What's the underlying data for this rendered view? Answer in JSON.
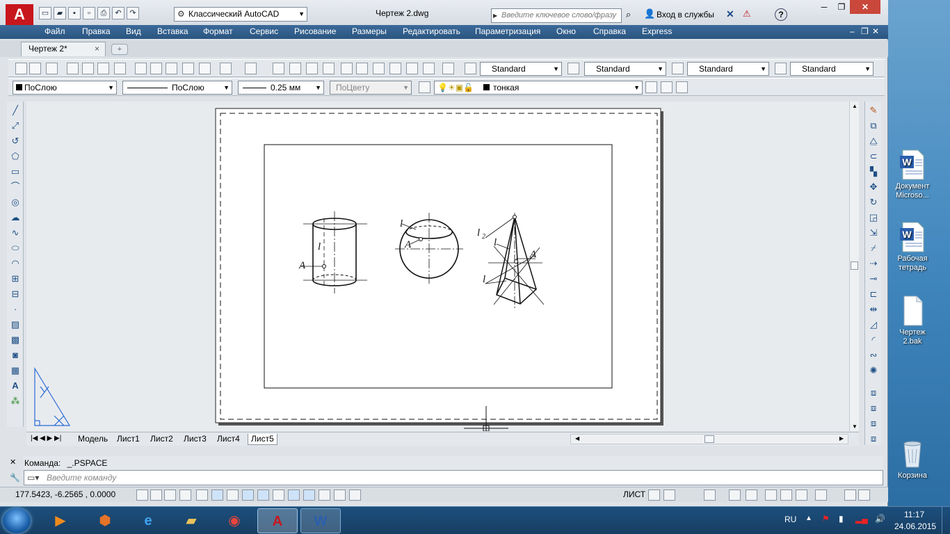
{
  "app": {
    "logo_letter": "A",
    "workspace": "Классический AutoCAD",
    "doc_title": "Чертеж 2.dwg",
    "search_placeholder": "Введите ключевое слово/фразу",
    "signin": "Вход в службы",
    "help": "?"
  },
  "menu": [
    "Файл",
    "Правка",
    "Вид",
    "Вставка",
    "Формат",
    "Сервис",
    "Рисование",
    "Размеры",
    "Редактировать",
    "Параметризация",
    "Окно",
    "Справка",
    "Express"
  ],
  "doc_tab": {
    "label": "Чертеж 2*",
    "close": "×",
    "new": "+"
  },
  "styles": {
    "text_style": "Standard",
    "dim_style": "Standard",
    "table_style": "Standard",
    "mleader_style": "Standard"
  },
  "properties": {
    "color": "ПоСлою",
    "linetype": "ПоСлою",
    "lineweight": "0.25 мм",
    "plotstyle": "ПоЦвету",
    "layer": "тонкая"
  },
  "drawing": {
    "labels": {
      "cyl_l": "l",
      "cyl_a": "A",
      "sph_l": "l",
      "sph_a": "A",
      "pyr_l2": "l",
      "pyr_l2_sub": "2",
      "pyr_l1": "l",
      "pyr_l": "l",
      "pyr_a": "A"
    }
  },
  "layout_tabs": [
    "Модель",
    "Лист1",
    "Лист2",
    "Лист3",
    "Лист4",
    "Лист5"
  ],
  "command": {
    "history_label": "Команда:",
    "history_value": "_.PSPACE",
    "placeholder": "Введите команду"
  },
  "status": {
    "coords": "177.5423, -6.2565 , 0.0000",
    "space": "ЛИСТ"
  },
  "desktop_icons": [
    {
      "label": "Документ Microso...",
      "type": "word"
    },
    {
      "label": "Рабочая тетрадь",
      "type": "word"
    },
    {
      "label": "Чертеж 2.bak",
      "type": "file"
    },
    {
      "label": "Корзина",
      "type": "bin"
    }
  ],
  "taskbar": {
    "lang": "RU",
    "time": "11:17",
    "date": "24.06.2015"
  },
  "colors": {
    "menubar": "#2b5580",
    "autocad_red": "#c8161d",
    "taskbar": "#173e63"
  }
}
